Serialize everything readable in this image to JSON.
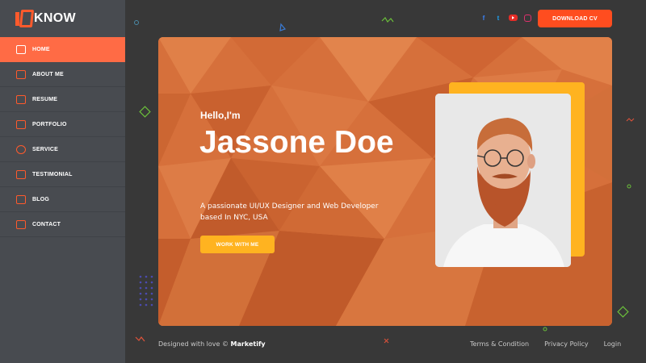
{
  "brand": {
    "logo_text": "KNOW",
    "accent": "#ff5a2c"
  },
  "sidebar": {
    "items": [
      {
        "label": "HOME",
        "icon": "grid-icon",
        "active": true
      },
      {
        "label": "ABOUT ME",
        "icon": "user-card-icon"
      },
      {
        "label": "RESUME",
        "icon": "document-icon"
      },
      {
        "label": "PORTFOLIO",
        "icon": "briefcase-icon"
      },
      {
        "label": "SERVICE",
        "icon": "gear-icon"
      },
      {
        "label": "TESTIMONIAL",
        "icon": "quote-icon"
      },
      {
        "label": "BLOG",
        "icon": "blog-icon"
      },
      {
        "label": "CONTACT",
        "icon": "mail-icon"
      }
    ]
  },
  "header": {
    "socials": [
      "facebook-icon",
      "twitter-icon",
      "youtube-icon",
      "instagram-icon"
    ],
    "download_label": "DOWNLOAD CV"
  },
  "hero": {
    "greeting": "Hello,I'm",
    "name": "Jassone Doe",
    "description": "A passionate UI/UX Designer and Web Developer based In NYC, USA",
    "cta_label": "WORK WITH ME"
  },
  "footer": {
    "credit_prefix": "Designed with love © ",
    "credit_brand": "Marketify",
    "links": [
      "Terms & Condition",
      "Privacy Policy",
      "Login"
    ]
  }
}
